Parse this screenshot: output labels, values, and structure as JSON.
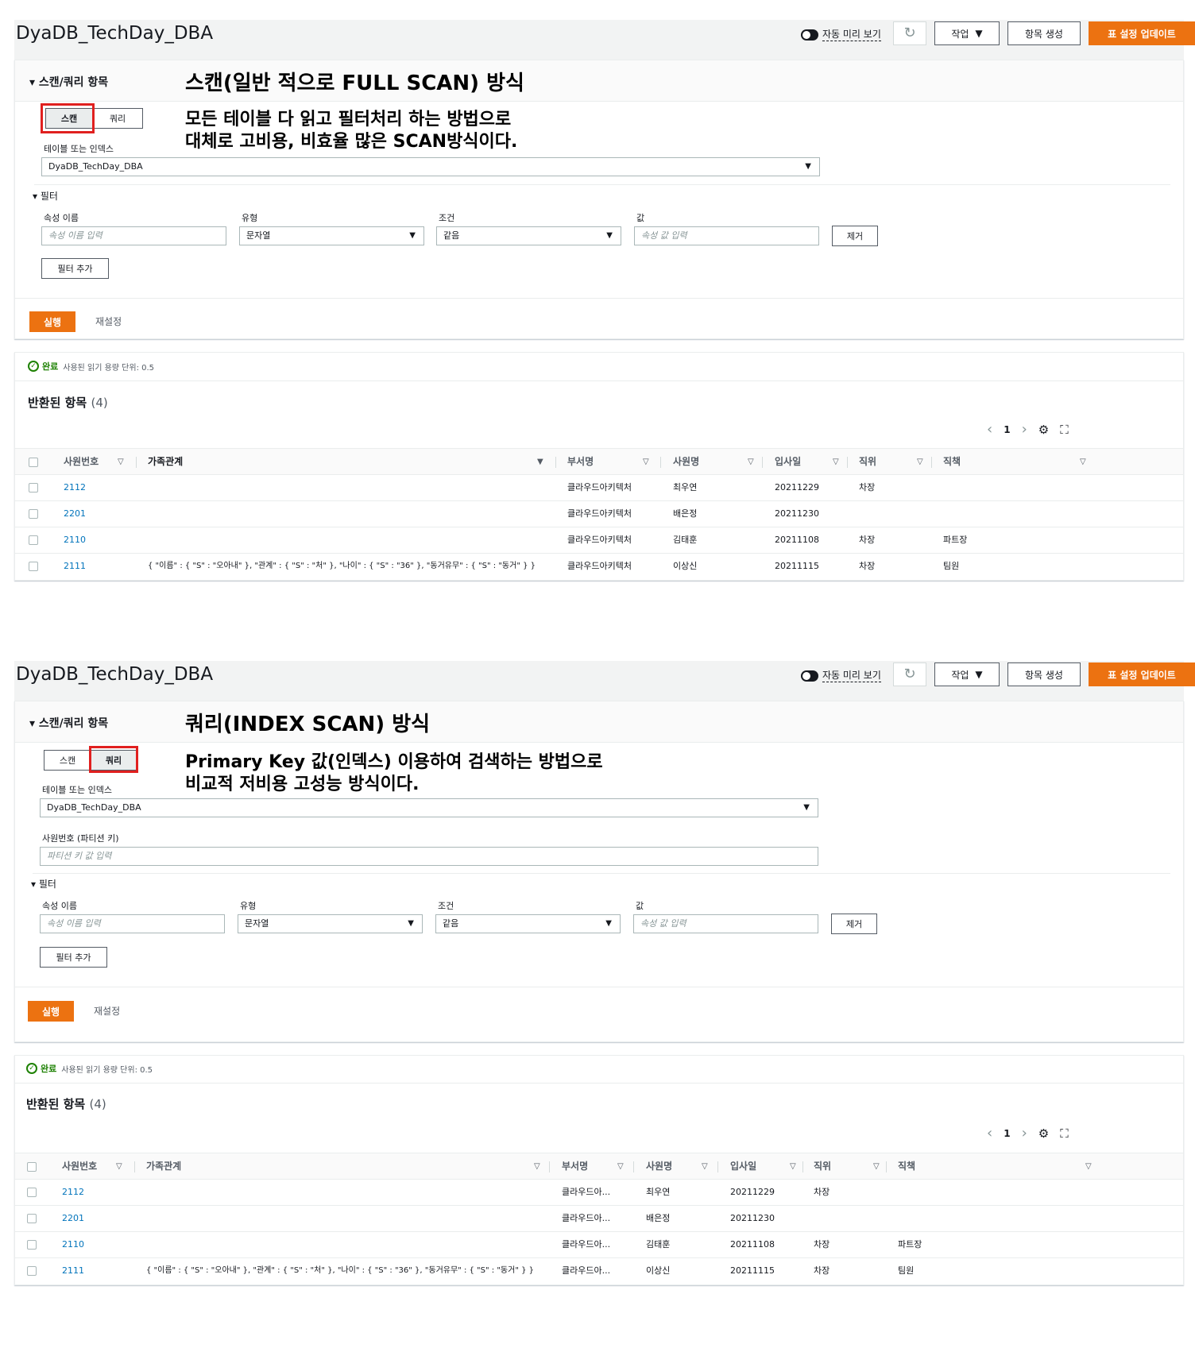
{
  "colors": {
    "accent": "#ec7211",
    "link": "#0073bb",
    "success": "#1d8102",
    "highlight": "#e0201f"
  },
  "screens": [
    {
      "page_title": "DyaDB_TechDay_DBA",
      "toolbar": {
        "auto_preview": "자동 미리 보기",
        "refresh_icon": "refresh-icon",
        "actions": "작업",
        "create_item": "항목 생성",
        "update_table": "표 설정 업데이트"
      },
      "panel_label": "스캔/쿼리 항목",
      "annotation_title": "스캔(일반 적으로 FULL SCAN) 방식",
      "annotation_line1": "모든 테이블 다 읽고 필터처리 하는 방법으로",
      "annotation_line2": "대체로 고비용, 비효율 많은 SCAN방식이다.",
      "mode": {
        "scan": "스캔",
        "query": "쿼리",
        "selected": "scan"
      },
      "table_index_label": "테이블 또는 인덱스",
      "table_index_value": "DyaDB_TechDay_DBA",
      "filter": {
        "toggle": "필터",
        "attr_label": "속성 이름",
        "attr_placeholder": "속성 이름 입력",
        "type_label": "유형",
        "type_value": "문자열",
        "cond_label": "조건",
        "cond_value": "같음",
        "value_label": "값",
        "value_placeholder": "속성 값 입력",
        "remove": "제거",
        "add": "필터 추가"
      },
      "run": "실행",
      "reset": "재설정",
      "status": {
        "done": "완료",
        "rcu": "사용된 읽기 용량 단위: 0.5"
      },
      "returned": {
        "label": "반환된 항목",
        "count": "(4)"
      },
      "pager": {
        "page": "1"
      },
      "columns": [
        "사원번호",
        "가족관계",
        "부서명",
        "사원명",
        "입사일",
        "직위",
        "직책"
      ],
      "rows": [
        {
          "id": "2112",
          "family": "",
          "dept": "클라우드아키텍처",
          "name": "최우연",
          "date": "20211229",
          "pos": "차장",
          "role": ""
        },
        {
          "id": "2201",
          "family": "",
          "dept": "클라우드아키텍처",
          "name": "배은정",
          "date": "20211230",
          "pos": "",
          "role": ""
        },
        {
          "id": "2110",
          "family": "",
          "dept": "클라우드아키텍처",
          "name": "김태훈",
          "date": "20211108",
          "pos": "차장",
          "role": "파트장"
        },
        {
          "id": "2111",
          "family": "{ \"이름\" : { \"S\" : \"오아내\" }, \"관계\" : { \"S\" : \"처\" }, \"나이\" : { \"S\" : \"36\" }, \"동거유무\" : { \"S\" : \"동거\" } }",
          "dept": "클라우드아키텍처",
          "name": "이상신",
          "date": "20211115",
          "pos": "차장",
          "role": "팀원"
        }
      ]
    },
    {
      "page_title": "DyaDB_TechDay_DBA",
      "toolbar": {
        "auto_preview": "자동 미리 보기",
        "refresh_icon": "refresh-icon",
        "actions": "작업",
        "create_item": "항목 생성",
        "update_table": "표 설정 업데이트"
      },
      "panel_label": "스캔/쿼리 항목",
      "annotation_title": "쿼리(INDEX SCAN) 방식",
      "annotation_line1": "Primary Key 값(인덱스) 이용하여 검색하는 방법으로",
      "annotation_line2": "비교적 저비용 고성능 방식이다.",
      "mode": {
        "scan": "스캔",
        "query": "쿼리",
        "selected": "query"
      },
      "table_index_label": "테이블 또는 인덱스",
      "table_index_value": "DyaDB_TechDay_DBA",
      "partition_label": "사원번호 (파티션 키)",
      "partition_placeholder": "파티션 키 값 입력",
      "filter": {
        "toggle": "필터",
        "attr_label": "속성 이름",
        "attr_placeholder": "속성 이름 입력",
        "type_label": "유형",
        "type_value": "문자열",
        "cond_label": "조건",
        "cond_value": "같음",
        "value_label": "값",
        "value_placeholder": "속성 값 입력",
        "remove": "제거",
        "add": "필터 추가"
      },
      "run": "실행",
      "reset": "재설정",
      "status": {
        "done": "완료",
        "rcu": "사용된 읽기 용량 단위: 0.5"
      },
      "returned": {
        "label": "반환된 항목",
        "count": "(4)"
      },
      "pager": {
        "page": "1"
      },
      "columns": [
        "사원번호",
        "가족관계",
        "부서명",
        "사원명",
        "입사일",
        "직위",
        "직책"
      ],
      "rows": [
        {
          "id": "2112",
          "family": "",
          "dept": "클라우드아...",
          "name": "최우연",
          "date": "20211229",
          "pos": "차장",
          "role": ""
        },
        {
          "id": "2201",
          "family": "",
          "dept": "클라우드아...",
          "name": "배은정",
          "date": "20211230",
          "pos": "",
          "role": ""
        },
        {
          "id": "2110",
          "family": "",
          "dept": "클라우드아...",
          "name": "김태훈",
          "date": "20211108",
          "pos": "차장",
          "role": "파트장"
        },
        {
          "id": "2111",
          "family": "{ \"이름\" : { \"S\" : \"오아내\" }, \"관계\" : { \"S\" : \"처\" }, \"나이\" : { \"S\" : \"36\" }, \"동거유무\" : { \"S\" : \"동거\" } }",
          "dept": "클라우드아...",
          "name": "이상신",
          "date": "20211115",
          "pos": "차장",
          "role": "팀원"
        }
      ]
    }
  ]
}
